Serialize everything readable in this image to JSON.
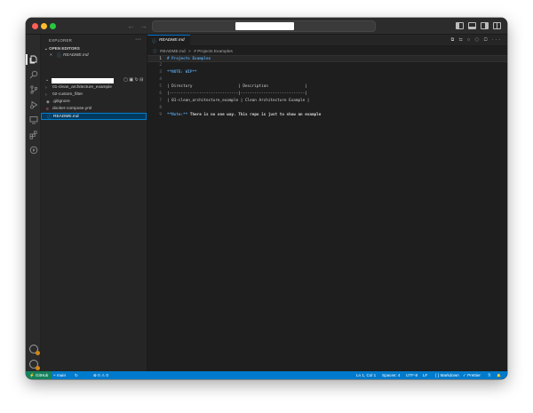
{
  "sidebar": {
    "title": "EXPLORER",
    "more": "···",
    "open_editors_label": "OPEN EDITORS",
    "open_editor_item": "README.md",
    "open_editor_close": "×",
    "tree": [
      {
        "label": "01-clean_architecture_example",
        "type": "folder"
      },
      {
        "label": "02-custom_filter",
        "type": "folder"
      },
      {
        "label": ".gitignore",
        "type": "file"
      },
      {
        "label": "docker-compose.yml",
        "type": "file"
      },
      {
        "label": "README.md",
        "type": "file"
      }
    ]
  },
  "editor": {
    "tab_label": "README.md",
    "breadcrumb": [
      "README.md",
      ">",
      "# Projects Examples"
    ],
    "lines": [
      {
        "n": "1",
        "text": "# Projects Examples",
        "style": "heading"
      },
      {
        "n": "2",
        "text": "",
        "style": ""
      },
      {
        "n": "3",
        "text": "**NOTE: WIP**",
        "style": "bold"
      },
      {
        "n": "4",
        "text": "",
        "style": ""
      },
      {
        "n": "5",
        "text": "| Directory                    | Description                |",
        "style": "table"
      },
      {
        "n": "6",
        "text": "|------------------------------|----------------------------|",
        "style": "table"
      },
      {
        "n": "7",
        "text": "| 01-clean_architecture_example | Clean Architecture Example |",
        "style": "table"
      },
      {
        "n": "8",
        "text": "",
        "style": ""
      },
      {
        "n": "9",
        "text": "**Note:** There is no one way. This repo is just to show an example",
        "style": "note"
      }
    ]
  },
  "statusbar": {
    "remote": "⚡ GitHub",
    "branch": "main",
    "sync": "↻",
    "problems": "⊗ 0 ⚠ 0",
    "position": "Ln 1, Col 1",
    "spaces": "Spaces: 4",
    "encoding": "UTF-8",
    "eol": "LF",
    "language": "{ } Markdown",
    "prettier": "✓ Prettier",
    "feedback": "ℛ",
    "bell": "🔔"
  },
  "titlebar": {
    "back": "←",
    "forward": "→"
  }
}
